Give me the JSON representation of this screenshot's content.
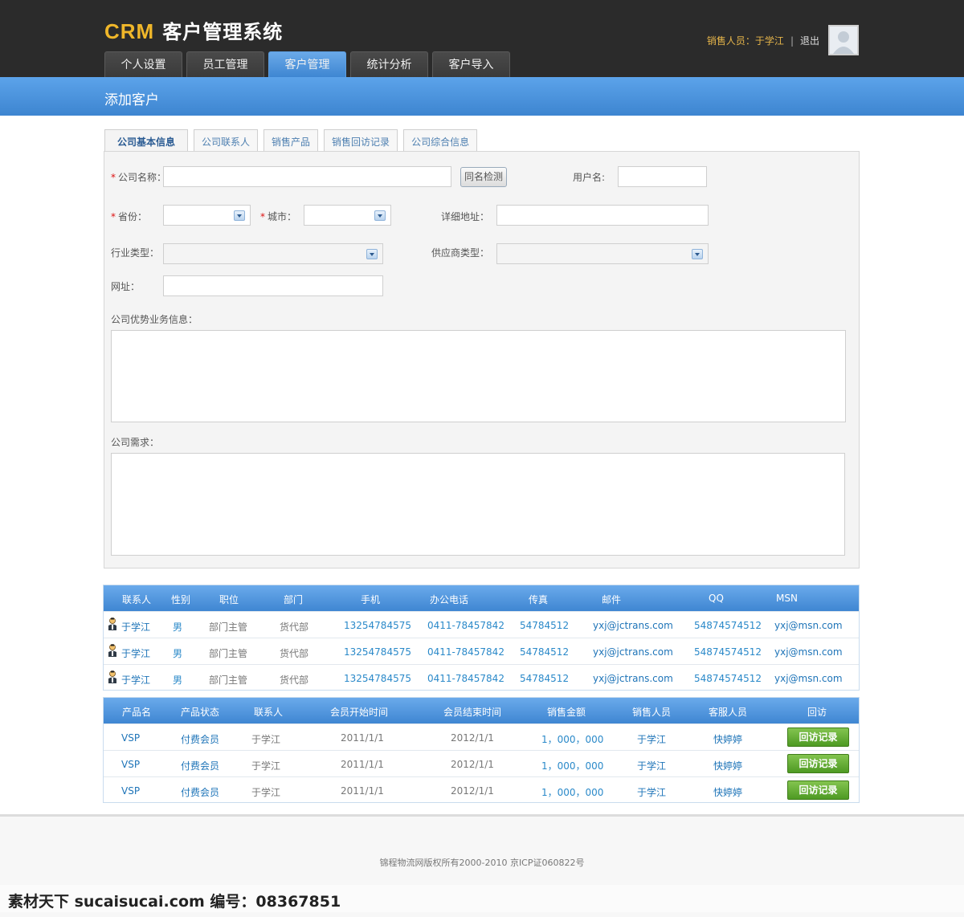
{
  "header": {
    "logo_crm": "CRM",
    "logo_text": "客户管理系统",
    "user_label": "销售人员：于学江",
    "separator": "|",
    "logout": "退出"
  },
  "nav": {
    "tabs": [
      {
        "label": "个人设置"
      },
      {
        "label": "员工管理"
      },
      {
        "label": "客户管理"
      },
      {
        "label": "统计分析"
      },
      {
        "label": "客户导入"
      }
    ],
    "active_index": 2
  },
  "banner": {
    "title": "添加客户"
  },
  "subtabs": [
    {
      "label": "公司基本信息"
    },
    {
      "label": "公司联系人"
    },
    {
      "label": "销售产品"
    },
    {
      "label": "销售回访记录"
    },
    {
      "label": "公司综合信息"
    }
  ],
  "form": {
    "company_name_label": "公司名称：",
    "check_button": "同名检测",
    "username_label": "用户名:",
    "province_label": "省份：",
    "city_label": "城市：",
    "address_label": "详细地址：",
    "industry_label": "行业类型：",
    "supplier_label": "供应商类型：",
    "website_label": "网址：",
    "advantage_label": "公司优势业务信息：",
    "demand_label": "公司需求：",
    "required_mark": "*"
  },
  "contacts": {
    "headers": [
      "联系人",
      "性别",
      "职位",
      "部门",
      "手机",
      "办公电话",
      "传真",
      "邮件",
      "QQ",
      "MSN"
    ],
    "rows": [
      [
        "于学江",
        "男",
        "部门主管",
        "货代部",
        "13254784575",
        "0411-78457842",
        "54784512",
        "yxj@jctrans.com",
        "54874574512",
        "yxj@msn.com"
      ],
      [
        "于学江",
        "男",
        "部门主管",
        "货代部",
        "13254784575",
        "0411-78457842",
        "54784512",
        "yxj@jctrans.com",
        "54874574512",
        "yxj@msn.com"
      ],
      [
        "于学江",
        "男",
        "部门主管",
        "货代部",
        "13254784575",
        "0411-78457842",
        "54784512",
        "yxj@jctrans.com",
        "54874574512",
        "yxj@msn.com"
      ]
    ]
  },
  "products": {
    "headers": [
      "产品名",
      "产品状态",
      "联系人",
      "会员开始时间",
      "会员结束时间",
      "销售金额",
      "销售人员",
      "客服人员",
      "回访"
    ],
    "rows": [
      [
        "VSP",
        "付费会员",
        "于学江",
        "2011/1/1",
        "2012/1/1",
        "1，000，000",
        "于学江",
        "快婷婷",
        "回访记录"
      ],
      [
        "VSP",
        "付费会员",
        "于学江",
        "2011/1/1",
        "2012/1/1",
        "1，000，000",
        "于学江",
        "快婷婷",
        "回访记录"
      ],
      [
        "VSP",
        "付费会员",
        "于学江",
        "2011/1/1",
        "2012/1/1",
        "1，000，000",
        "于学江",
        "快婷婷",
        "回访记录"
      ]
    ]
  },
  "footer": {
    "text": "锦程物流网版权所有2000-2010  京ICP证060822号"
  },
  "watermark": {
    "text": "素材天下 sucaisucai.com  编号：08367851"
  }
}
